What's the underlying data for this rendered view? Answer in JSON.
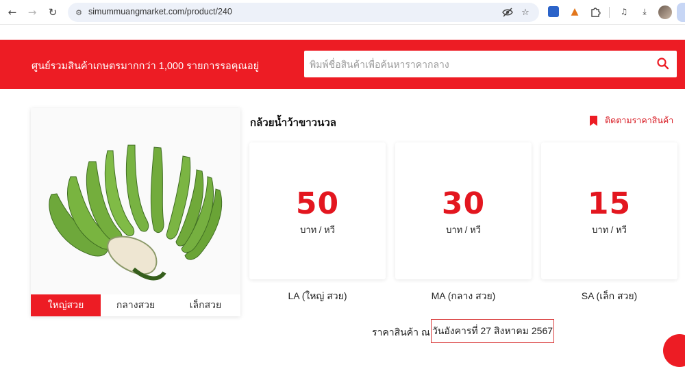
{
  "browser": {
    "url": "simummuangmarket.com/product/240",
    "icons": [
      "back-arrow-icon",
      "forward-arrow-icon",
      "reload-icon",
      "site-info-icon",
      "eye-off-icon",
      "bookmark-star-icon",
      "extension-icon",
      "metamask-fox-icon",
      "puzzle-icon",
      "media-queue-icon",
      "download-icon",
      "avatar"
    ]
  },
  "header": {
    "tagline": "ศูนย์รวมสินค้าเกษตรมากกว่า 1,000 รายการรอคุณอยู่",
    "search_placeholder": "พิมพ์ชื่อสินค้าเพื่อค้นหาราคากลาง",
    "brand_color": "#ed1c24"
  },
  "product": {
    "title": "กล้วยน้ำว้าขาวนวล",
    "follow_label": "ติดตามราคาสินค้า",
    "size_tabs": [
      {
        "label": "ใหญ่สวย",
        "active": true
      },
      {
        "label": "กลางสวย",
        "active": false
      },
      {
        "label": "เล็กสวย",
        "active": false
      }
    ],
    "prices": [
      {
        "value": "50",
        "unit": "บาท / หวี",
        "grade": "LA (ใหญ่ สวย)"
      },
      {
        "value": "30",
        "unit": "บาท / หวี",
        "grade": "MA (กลาง สวย)"
      },
      {
        "value": "15",
        "unit": "บาท / หวี",
        "grade": "SA (เล็ก สวย)"
      }
    ],
    "price_color": "#e3161f"
  },
  "date": {
    "caption": "ราคาสินค้า ณ",
    "value": "วันอังคารที่ 27 สิงหาคม 2567"
  }
}
